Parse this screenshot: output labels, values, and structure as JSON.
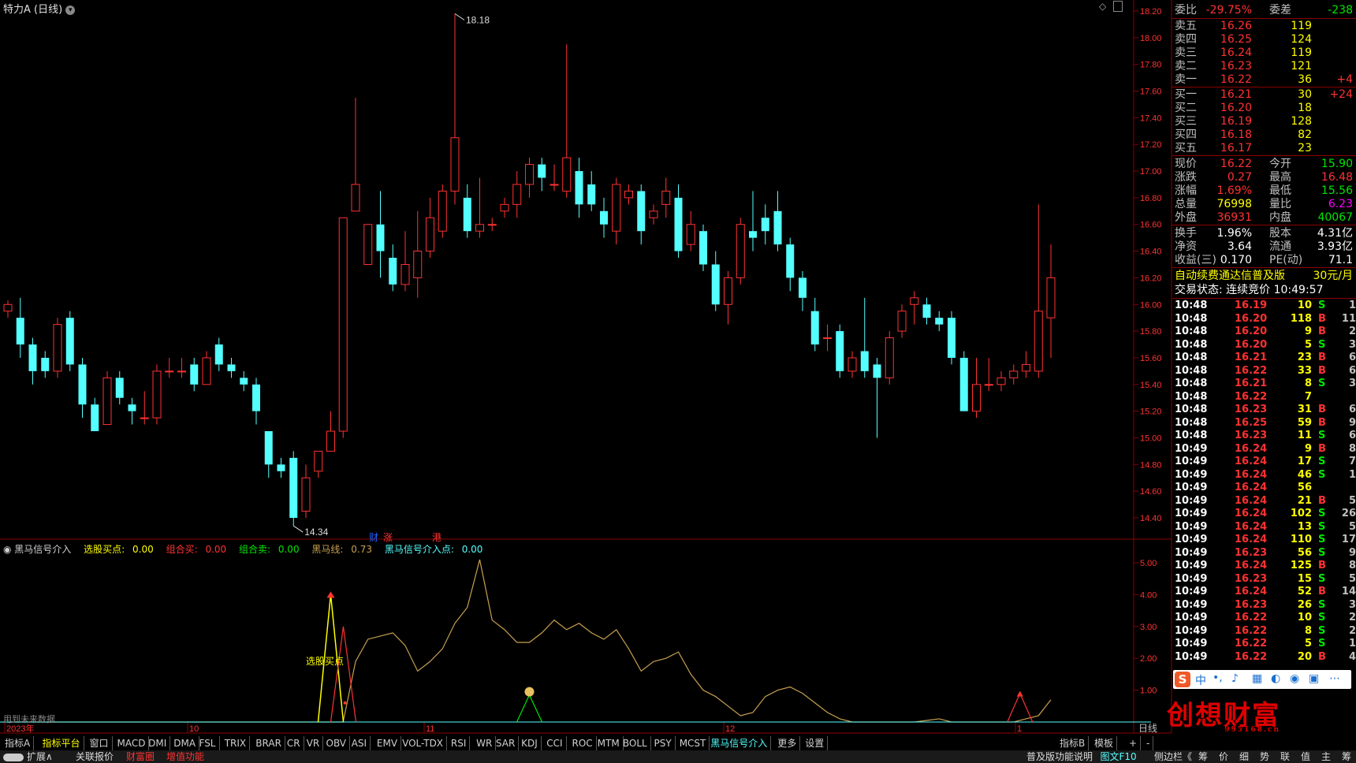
{
  "window": {
    "title": "特力A (日线)"
  },
  "chart_data": {
    "type": "candlestick",
    "price_axis": [
      "18.20",
      "18.00",
      "17.80",
      "17.60",
      "17.40",
      "17.20",
      "17.00",
      "16.80",
      "16.60",
      "16.40",
      "16.20",
      "16.00",
      "15.80",
      "15.60",
      "15.40",
      "15.20",
      "15.00",
      "14.80",
      "14.60",
      "14.40"
    ],
    "high_label": "18.18",
    "low_label": "14.34",
    "x_labels": [
      "2023年",
      "10",
      "11",
      "12",
      "1"
    ],
    "markers": [
      "财",
      "涨",
      "港"
    ],
    "candles": [
      [
        15.95,
        16.0,
        15.9,
        16.03
      ],
      [
        15.9,
        15.7,
        15.6,
        16.05
      ],
      [
        15.7,
        15.5,
        15.4,
        15.75
      ],
      [
        15.6,
        15.5,
        15.45,
        15.65
      ],
      [
        15.5,
        15.85,
        15.45,
        15.9
      ],
      [
        15.9,
        15.55,
        15.5,
        15.95
      ],
      [
        15.55,
        15.25,
        15.15,
        15.6
      ],
      [
        15.25,
        15.05,
        15.05,
        15.3
      ],
      [
        15.1,
        15.45,
        15.1,
        15.5
      ],
      [
        15.45,
        15.3,
        15.25,
        15.5
      ],
      [
        15.25,
        15.2,
        15.1,
        15.3
      ],
      [
        15.15,
        15.15,
        15.1,
        15.35
      ],
      [
        15.15,
        15.5,
        15.1,
        15.55
      ],
      [
        15.5,
        15.5,
        15.45,
        15.6
      ],
      [
        15.5,
        15.5,
        15.45,
        15.6
      ],
      [
        15.55,
        15.4,
        15.35,
        15.6
      ],
      [
        15.4,
        15.6,
        15.4,
        15.65
      ],
      [
        15.7,
        15.55,
        15.5,
        15.75
      ],
      [
        15.55,
        15.5,
        15.45,
        15.6
      ],
      [
        15.45,
        15.4,
        15.35,
        15.5
      ],
      [
        15.4,
        15.2,
        15.1,
        15.45
      ],
      [
        15.05,
        14.8,
        14.7,
        15.05
      ],
      [
        14.8,
        14.75,
        14.7,
        14.85
      ],
      [
        14.85,
        14.4,
        14.34,
        14.9
      ],
      [
        14.45,
        14.7,
        14.4,
        14.8
      ],
      [
        14.75,
        14.9,
        14.7,
        14.9
      ],
      [
        14.9,
        15.05,
        14.9,
        15.2
      ],
      [
        15.05,
        16.65,
        15.0,
        16.65
      ],
      [
        16.7,
        16.9,
        16.7,
        17.55
      ],
      [
        16.3,
        16.6,
        16.3,
        16.6
      ],
      [
        16.6,
        16.4,
        16.2,
        16.85
      ],
      [
        16.35,
        16.15,
        16.1,
        16.45
      ],
      [
        16.15,
        16.3,
        16.1,
        16.55
      ],
      [
        16.2,
        16.4,
        16.05,
        16.7
      ],
      [
        16.4,
        16.65,
        16.35,
        16.8
      ],
      [
        16.55,
        16.85,
        16.5,
        16.9
      ],
      [
        16.85,
        17.25,
        16.75,
        18.18
      ],
      [
        16.8,
        16.55,
        16.5,
        16.9
      ],
      [
        16.55,
        16.6,
        16.5,
        16.95
      ],
      [
        16.6,
        16.6,
        16.55,
        16.65
      ],
      [
        16.7,
        16.75,
        16.65,
        16.8
      ],
      [
        16.75,
        16.9,
        16.65,
        17.0
      ],
      [
        16.9,
        17.05,
        16.8,
        17.1
      ],
      [
        17.05,
        16.95,
        16.85,
        17.1
      ],
      [
        16.9,
        16.9,
        16.85,
        17.05
      ],
      [
        16.85,
        17.1,
        16.8,
        17.95
      ],
      [
        17.0,
        16.75,
        16.65,
        17.1
      ],
      [
        16.9,
        16.75,
        16.7,
        17.0
      ],
      [
        16.7,
        16.6,
        16.5,
        16.8
      ],
      [
        16.55,
        16.9,
        16.45,
        16.95
      ],
      [
        16.8,
        16.85,
        16.75,
        16.9
      ],
      [
        16.85,
        16.55,
        16.45,
        16.9
      ],
      [
        16.65,
        16.7,
        16.6,
        16.75
      ],
      [
        16.75,
        16.85,
        16.65,
        16.95
      ],
      [
        16.8,
        16.4,
        16.35,
        16.9
      ],
      [
        16.45,
        16.6,
        16.4,
        16.7
      ],
      [
        16.55,
        16.3,
        16.25,
        16.6
      ],
      [
        16.3,
        16.0,
        15.95,
        16.4
      ],
      [
        16.0,
        16.2,
        15.85,
        16.25
      ],
      [
        16.2,
        16.6,
        16.15,
        16.65
      ],
      [
        16.55,
        16.5,
        16.4,
        16.85
      ],
      [
        16.65,
        16.55,
        16.45,
        16.75
      ],
      [
        16.7,
        16.45,
        16.4,
        16.85
      ],
      [
        16.45,
        16.2,
        16.1,
        16.5
      ],
      [
        16.2,
        16.05,
        15.95,
        16.25
      ],
      [
        15.95,
        15.7,
        15.65,
        16.05
      ],
      [
        15.75,
        15.75,
        15.65,
        15.85
      ],
      [
        15.8,
        15.5,
        15.45,
        15.85
      ],
      [
        15.5,
        15.6,
        15.45,
        15.65
      ],
      [
        15.65,
        15.5,
        15.45,
        16.05
      ],
      [
        15.55,
        15.45,
        15.0,
        15.6
      ],
      [
        15.45,
        15.75,
        15.4,
        15.8
      ],
      [
        15.8,
        15.95,
        15.75,
        16.0
      ],
      [
        16.0,
        16.05,
        15.85,
        16.1
      ],
      [
        16.0,
        15.9,
        15.85,
        16.05
      ],
      [
        15.9,
        15.85,
        15.8,
        15.95
      ],
      [
        15.9,
        15.6,
        15.55,
        15.95
      ],
      [
        15.6,
        15.2,
        15.2,
        15.65
      ],
      [
        15.2,
        15.4,
        15.15,
        15.6
      ],
      [
        15.4,
        15.4,
        15.35,
        15.6
      ],
      [
        15.4,
        15.45,
        15.35,
        15.5
      ],
      [
        15.45,
        15.5,
        15.4,
        15.55
      ],
      [
        15.5,
        15.55,
        15.45,
        15.65
      ],
      [
        15.5,
        15.95,
        15.45,
        16.75
      ],
      [
        15.9,
        16.2,
        15.6,
        16.45
      ]
    ],
    "indicator": {
      "name": "黑马信号介入",
      "params": [
        {
          "label": "选股买点:",
          "value": "0.00"
        },
        {
          "label": "组合买:",
          "value": "0.00"
        },
        {
          "label": "组合卖:",
          "value": "0.00"
        },
        {
          "label": "黑马线:",
          "value": "0.73"
        },
        {
          "label": "黑马信号介入点:",
          "value": "0.00"
        }
      ],
      "y_axis": [
        "5.00",
        "4.00",
        "3.00",
        "2.00",
        "1.00"
      ],
      "annotation": "选股买点",
      "future_note": "用到未来数据",
      "curve": [
        0,
        0,
        0,
        0,
        0,
        0,
        0,
        0,
        0,
        0,
        0,
        0,
        0,
        0,
        0,
        0,
        0,
        0,
        0,
        0,
        0,
        0,
        0,
        0,
        0,
        0,
        0,
        0,
        1.9,
        2.6,
        2.7,
        2.8,
        2.4,
        1.6,
        1.9,
        2.3,
        3.1,
        3.6,
        5.1,
        3.2,
        2.9,
        2.5,
        2.5,
        2.8,
        3.2,
        2.9,
        3.1,
        2.8,
        2.6,
        2.9,
        2.3,
        1.6,
        1.9,
        2.0,
        2.2,
        1.5,
        1.0,
        0.8,
        0.5,
        0.2,
        0.3,
        0.8,
        1.0,
        1.1,
        0.9,
        0.6,
        0.3,
        0.1,
        0,
        0,
        0,
        0,
        0,
        0,
        0.05,
        0.1,
        0,
        0,
        0,
        0,
        0,
        0,
        0.1,
        0.2,
        0.7
      ],
      "yellow_spike": 4.0,
      "red_spike": 3.0
    }
  },
  "quote": {
    "weibi_label": "委比",
    "weibi": "-29.75%",
    "weicha_label": "委差",
    "weicha": "-238",
    "asks": [
      {
        "label": "卖五",
        "price": "16.26",
        "vol": "119",
        "extra": ""
      },
      {
        "label": "卖四",
        "price": "16.25",
        "vol": "124",
        "extra": ""
      },
      {
        "label": "卖三",
        "price": "16.24",
        "vol": "119",
        "extra": ""
      },
      {
        "label": "卖二",
        "price": "16.23",
        "vol": "121",
        "extra": ""
      },
      {
        "label": "卖一",
        "price": "16.22",
        "vol": "36",
        "extra": "+4"
      }
    ],
    "bids": [
      {
        "label": "买一",
        "price": "16.21",
        "vol": "30",
        "extra": "+24"
      },
      {
        "label": "买二",
        "price": "16.20",
        "vol": "18",
        "extra": ""
      },
      {
        "label": "买三",
        "price": "16.19",
        "vol": "128",
        "extra": ""
      },
      {
        "label": "买四",
        "price": "16.18",
        "vol": "82",
        "extra": ""
      },
      {
        "label": "买五",
        "price": "16.17",
        "vol": "23",
        "extra": ""
      }
    ],
    "stats": [
      {
        "l1": "现价",
        "v1": "16.22",
        "c1": "red",
        "l2": "今开",
        "v2": "15.90",
        "c2": "green"
      },
      {
        "l1": "涨跌",
        "v1": "0.27",
        "c1": "red",
        "l2": "最高",
        "v2": "16.48",
        "c2": "red"
      },
      {
        "l1": "涨幅",
        "v1": "1.69%",
        "c1": "red",
        "l2": "最低",
        "v2": "15.56",
        "c2": "green"
      },
      {
        "l1": "总量",
        "v1": "76998",
        "c1": "yellow",
        "l2": "量比",
        "v2": "6.23",
        "c2": "purple"
      },
      {
        "l1": "外盘",
        "v1": "36931",
        "c1": "red",
        "l2": "内盘",
        "v2": "40067",
        "c2": "green"
      }
    ],
    "stats2": [
      {
        "l1": "换手",
        "v1": "1.96%",
        "l2": "股本",
        "v2": "4.31亿"
      },
      {
        "l1": "净资",
        "v1": "3.64",
        "l2": "流通",
        "v2": "3.93亿"
      },
      {
        "l1": "收益(三)",
        "v1": "0.170",
        "l2": "PE(动)",
        "v2": "71.1"
      }
    ],
    "promo": "自动续费通达信普及版",
    "promo_price": "30元/月",
    "trade_status": "交易状态: 连续竞价 10:49:57"
  },
  "ticks": [
    [
      "10:48",
      "16.19",
      "10",
      "S",
      "1"
    ],
    [
      "10:48",
      "16.20",
      "118",
      "B",
      "11"
    ],
    [
      "10:48",
      "16.20",
      "9",
      "B",
      "2"
    ],
    [
      "10:48",
      "16.20",
      "5",
      "S",
      "3"
    ],
    [
      "10:48",
      "16.21",
      "23",
      "B",
      "6"
    ],
    [
      "10:48",
      "16.22",
      "33",
      "B",
      "6"
    ],
    [
      "10:48",
      "16.21",
      "8",
      "S",
      "3"
    ],
    [
      "10:48",
      "16.22",
      "7",
      "",
      ""
    ],
    [
      "10:48",
      "16.23",
      "31",
      "B",
      "6"
    ],
    [
      "10:48",
      "16.25",
      "59",
      "B",
      "9"
    ],
    [
      "10:48",
      "16.23",
      "11",
      "S",
      "6"
    ],
    [
      "10:49",
      "16.24",
      "9",
      "B",
      "8"
    ],
    [
      "10:49",
      "16.24",
      "17",
      "S",
      "7"
    ],
    [
      "10:49",
      "16.24",
      "46",
      "S",
      "1"
    ],
    [
      "10:49",
      "16.24",
      "56",
      "",
      ""
    ],
    [
      "10:49",
      "16.24",
      "21",
      "B",
      "5"
    ],
    [
      "10:49",
      "16.24",
      "102",
      "S",
      "26"
    ],
    [
      "10:49",
      "16.24",
      "13",
      "S",
      "5"
    ],
    [
      "10:49",
      "16.24",
      "110",
      "S",
      "17"
    ],
    [
      "10:49",
      "16.23",
      "56",
      "S",
      "9"
    ],
    [
      "10:49",
      "16.24",
      "125",
      "B",
      "8"
    ],
    [
      "10:49",
      "16.23",
      "15",
      "S",
      "5"
    ],
    [
      "10:49",
      "16.24",
      "52",
      "B",
      "14"
    ],
    [
      "10:49",
      "16.23",
      "26",
      "S",
      "3"
    ],
    [
      "10:49",
      "16.22",
      "10",
      "S",
      "2"
    ],
    [
      "10:49",
      "16.22",
      "8",
      "S",
      "2"
    ],
    [
      "10:49",
      "16.22",
      "5",
      "S",
      "1"
    ],
    [
      "10:49",
      "16.22",
      "20",
      "B",
      "4"
    ]
  ],
  "tabs": [
    "指标A",
    "指标平台",
    "窗口",
    "MACD",
    "DMI",
    "DMA",
    "FSL",
    "TRIX",
    "BRAR",
    "CR",
    "VR",
    "OBV",
    "ASI",
    "EMV",
    "VOL-TDX",
    "RSI",
    "WR",
    "SAR",
    "KDJ",
    "CCI",
    "ROC",
    "MTM",
    "BOLL",
    "PSY",
    "MCST",
    "黑马信号介入",
    "更多",
    "设置"
  ],
  "tabs_right": [
    "指标B",
    "模板",
    "+",
    "-"
  ],
  "period_label": "日线",
  "status": {
    "toggle": "扩展∧",
    "items": [
      "关联报价",
      "财富圈",
      "增值功能"
    ],
    "right": [
      "普及版功能说明",
      "图文F10",
      "侧边栏《",
      "筹",
      "价",
      "细",
      "势",
      "联",
      "值",
      "主",
      "筹"
    ]
  },
  "watermark": "创想财富",
  "watermark_url": "995168.cn",
  "colors": {
    "up": "#ff3232",
    "down": "#54ffff",
    "axis": "#8b0000",
    "text": "#c0c0c0"
  }
}
